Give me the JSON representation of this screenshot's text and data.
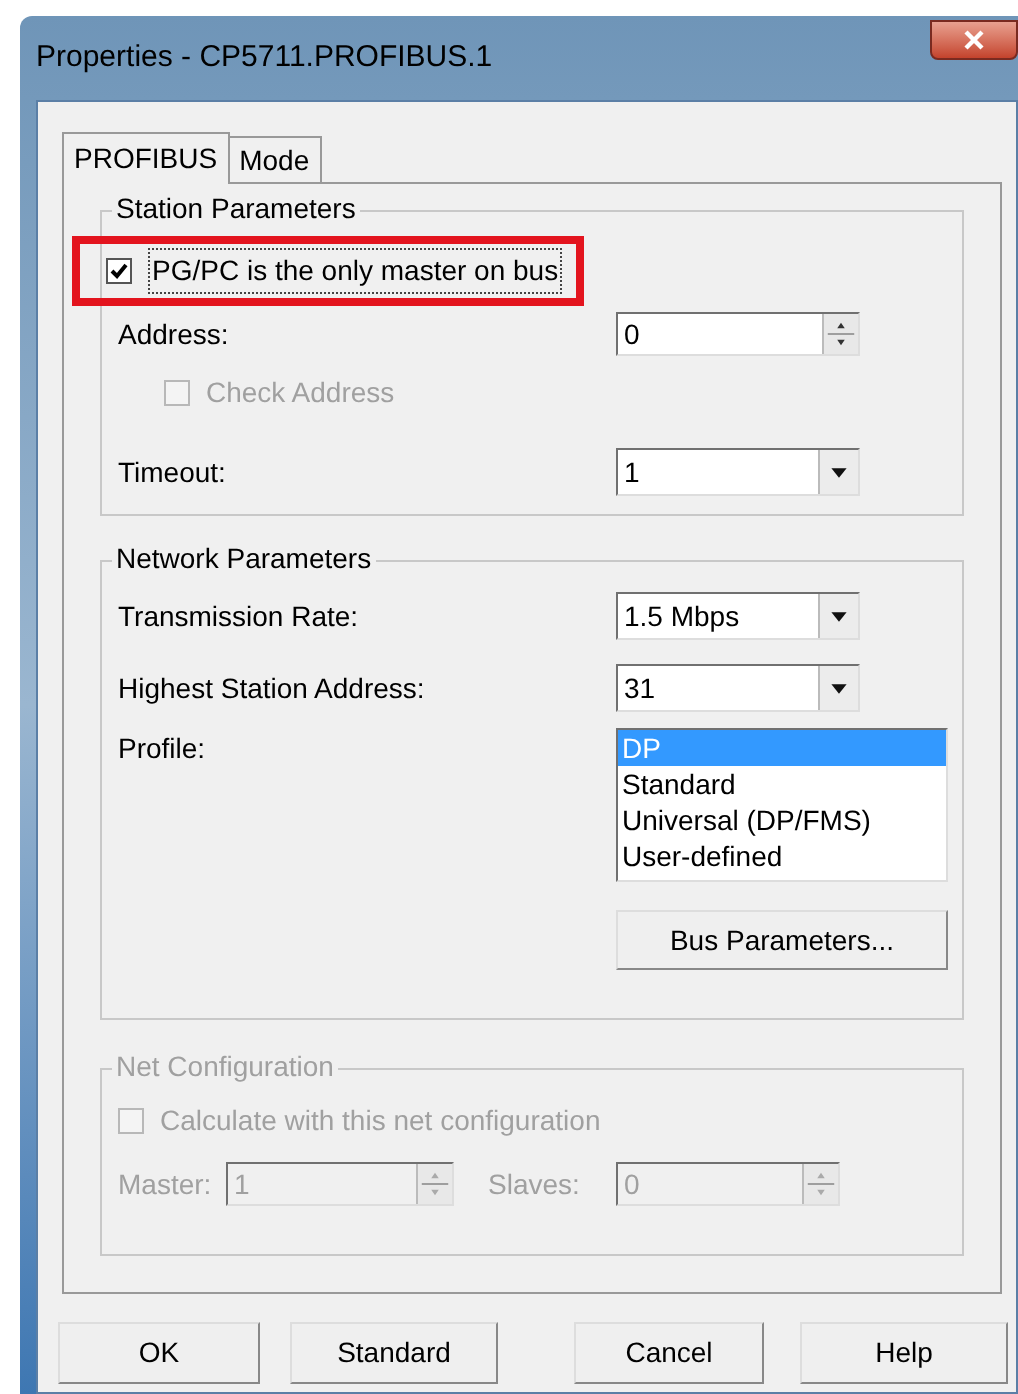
{
  "window": {
    "title": "Properties - CP5711.PROFIBUS.1"
  },
  "tabs": [
    {
      "label": "PROFIBUS",
      "selected": true
    },
    {
      "label": "Mode",
      "selected": false
    }
  ],
  "station_parameters": {
    "title": "Station Parameters",
    "only_master": {
      "label": "PG/PC is the only master on bus",
      "checked": true,
      "highlighted": true
    },
    "address": {
      "label": "Address:",
      "value": "0"
    },
    "check_address": {
      "label": "Check Address",
      "checked": false,
      "disabled": true
    },
    "timeout": {
      "label": "Timeout:",
      "value": "1"
    }
  },
  "network_parameters": {
    "title": "Network Parameters",
    "transmission_rate": {
      "label": "Transmission Rate:",
      "value": "1.5 Mbps"
    },
    "highest_station_address": {
      "label": "Highest Station Address:",
      "value": "31"
    },
    "profile": {
      "label": "Profile:",
      "options": [
        {
          "label": "DP",
          "selected": true
        },
        {
          "label": "Standard",
          "selected": false
        },
        {
          "label": "Universal (DP/FMS)",
          "selected": false
        },
        {
          "label": "User-defined",
          "selected": false
        }
      ]
    },
    "bus_parameters_button": "Bus Parameters..."
  },
  "net_configuration": {
    "title": "Net Configuration",
    "disabled": true,
    "calculate": {
      "label": "Calculate with this net configuration",
      "checked": false,
      "disabled": true
    },
    "master": {
      "label": "Master:",
      "value": "1"
    },
    "slaves": {
      "label": "Slaves:",
      "value": "0"
    }
  },
  "buttons": [
    "OK",
    "Standard",
    "Cancel",
    "Help"
  ]
}
